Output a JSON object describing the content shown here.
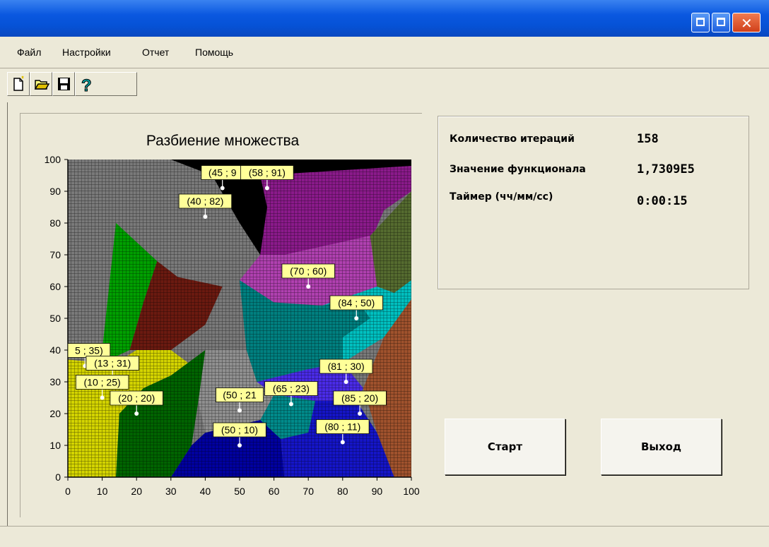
{
  "menu": [
    "Файл",
    "Настройки",
    "Отчет",
    "Помощь"
  ],
  "toolbar": [
    {
      "name": "new-file-icon"
    },
    {
      "name": "open-folder-icon"
    },
    {
      "name": "save-disk-icon"
    },
    {
      "name": "help-question-icon"
    }
  ],
  "info": {
    "iterations_label": "Количество итераций",
    "iterations_value": "158",
    "functional_label": "Значение функционала",
    "functional_value": "1,7309E5",
    "timer_label": "Таймер (чч/мм/сс)",
    "timer_value": "0:00:15"
  },
  "buttons": {
    "start": "Старт",
    "exit": "Выход"
  },
  "chart_data": {
    "type": "scatter",
    "title": "Разбиение множества",
    "xlim": [
      0,
      100
    ],
    "ylim": [
      0,
      100
    ],
    "xticks": [
      0,
      10,
      20,
      30,
      40,
      50,
      60,
      70,
      80,
      90,
      100
    ],
    "yticks": [
      0,
      10,
      20,
      30,
      40,
      50,
      60,
      70,
      80,
      90,
      100
    ],
    "grid": true,
    "points": [
      {
        "x": 45,
        "y": 91,
        "label": "(45 ; 9"
      },
      {
        "x": 58,
        "y": 91,
        "label": "(58 ; 91)"
      },
      {
        "x": 40,
        "y": 82,
        "label": "(40 ; 82)"
      },
      {
        "x": 70,
        "y": 60,
        "label": "(70 ; 60)"
      },
      {
        "x": 84,
        "y": 50,
        "label": "(84 ; 50)"
      },
      {
        "x": 5,
        "y": 35,
        "label": "5 ; 35)"
      },
      {
        "x": 13,
        "y": 31,
        "label": "(13 ; 31)"
      },
      {
        "x": 10,
        "y": 25,
        "label": "(10 ; 25)"
      },
      {
        "x": 20,
        "y": 20,
        "label": "(20 ; 20)"
      },
      {
        "x": 50,
        "y": 21,
        "label": "(50 ; 21"
      },
      {
        "x": 65,
        "y": 23,
        "label": "(65 ; 23)"
      },
      {
        "x": 81,
        "y": 30,
        "label": "(81 ; 30)"
      },
      {
        "x": 85,
        "y": 20,
        "label": "(85 ; 20)"
      },
      {
        "x": 80,
        "y": 11,
        "label": "(80 ; 11)"
      },
      {
        "x": 50,
        "y": 10,
        "label": "(50 ; 10)"
      }
    ],
    "regions": [
      {
        "color": "#7a7a7a",
        "pts": [
          [
            0,
            100
          ],
          [
            100,
            100
          ],
          [
            100,
            0
          ],
          [
            0,
            0
          ]
        ]
      },
      {
        "color": "#000000",
        "pts": [
          [
            30,
            100
          ],
          [
            100,
            100
          ],
          [
            100,
            98
          ],
          [
            85,
            95
          ],
          [
            60,
            87
          ],
          [
            56,
            70
          ],
          [
            50,
            80
          ],
          [
            42,
            95
          ]
        ]
      },
      {
        "color": "#000000",
        "pts": [
          [
            48,
            100
          ],
          [
            58,
            100
          ],
          [
            62,
            88
          ],
          [
            56,
            70
          ],
          [
            52,
            78
          ]
        ]
      },
      {
        "color": "#8b1a8b",
        "pts": [
          [
            56,
            95
          ],
          [
            100,
            98
          ],
          [
            100,
            90
          ],
          [
            92,
            84
          ],
          [
            88,
            74
          ],
          [
            63,
            64
          ],
          [
            56,
            70
          ],
          [
            58,
            85
          ]
        ]
      },
      {
        "color": "#b040b0",
        "pts": [
          [
            50,
            62
          ],
          [
            56,
            70
          ],
          [
            63,
            70
          ],
          [
            88,
            76
          ],
          [
            90,
            60
          ],
          [
            84,
            56
          ],
          [
            74,
            54
          ],
          [
            60,
            55
          ]
        ]
      },
      {
        "color": "#556b2f",
        "pts": [
          [
            88,
            76
          ],
          [
            100,
            90
          ],
          [
            100,
            60
          ],
          [
            95,
            58
          ],
          [
            90,
            60
          ]
        ]
      },
      {
        "color": "#008080",
        "pts": [
          [
            50,
            62
          ],
          [
            60,
            55
          ],
          [
            74,
            54
          ],
          [
            84,
            56
          ],
          [
            88,
            50
          ],
          [
            80,
            36
          ],
          [
            70,
            34
          ],
          [
            55,
            30
          ],
          [
            52,
            40
          ]
        ]
      },
      {
        "color": "#00c0c0",
        "pts": [
          [
            74,
            54
          ],
          [
            90,
            60
          ],
          [
            95,
            58
          ],
          [
            100,
            62
          ],
          [
            100,
            56
          ],
          [
            92,
            44
          ],
          [
            80,
            36
          ],
          [
            80,
            44
          ],
          [
            88,
            50
          ],
          [
            84,
            56
          ]
        ]
      },
      {
        "color": "#a0522d",
        "pts": [
          [
            92,
            44
          ],
          [
            100,
            56
          ],
          [
            100,
            0
          ],
          [
            95,
            0
          ],
          [
            90,
            14
          ],
          [
            86,
            28
          ]
        ]
      },
      {
        "color": "#4a2be8",
        "pts": [
          [
            55,
            30
          ],
          [
            70,
            34
          ],
          [
            80,
            36
          ],
          [
            86,
            28
          ],
          [
            84,
            24
          ],
          [
            72,
            24
          ],
          [
            60,
            26
          ]
        ]
      },
      {
        "color": "#008b8b",
        "pts": [
          [
            56,
            18
          ],
          [
            60,
            26
          ],
          [
            72,
            24
          ],
          [
            70,
            14
          ],
          [
            62,
            12
          ]
        ]
      },
      {
        "color": "#0000a0",
        "pts": [
          [
            30,
            0
          ],
          [
            63,
            0
          ],
          [
            62,
            12
          ],
          [
            56,
            18
          ],
          [
            40,
            14
          ],
          [
            36,
            10
          ]
        ]
      },
      {
        "color": "#1515c8",
        "pts": [
          [
            63,
            0
          ],
          [
            95,
            0
          ],
          [
            90,
            14
          ],
          [
            84,
            24
          ],
          [
            72,
            24
          ],
          [
            70,
            14
          ],
          [
            62,
            12
          ]
        ]
      },
      {
        "color": "#909090",
        "pts": [
          [
            38,
            24
          ],
          [
            40,
            14
          ],
          [
            56,
            18
          ],
          [
            60,
            26
          ],
          [
            55,
            30
          ],
          [
            52,
            40
          ],
          [
            40,
            40
          ]
        ]
      },
      {
        "color": "#00a000",
        "pts": [
          [
            14,
            80
          ],
          [
            26,
            68
          ],
          [
            22,
            55
          ],
          [
            18,
            40
          ],
          [
            10,
            36
          ],
          [
            10,
            40
          ]
        ]
      },
      {
        "color": "#6b1a10",
        "pts": [
          [
            22,
            55
          ],
          [
            26,
            68
          ],
          [
            32,
            63
          ],
          [
            45,
            60
          ],
          [
            40,
            48
          ],
          [
            30,
            40
          ],
          [
            18,
            40
          ]
        ]
      },
      {
        "color": "#d4d400",
        "pts": [
          [
            0,
            37
          ],
          [
            0,
            0
          ],
          [
            14,
            0
          ],
          [
            15,
            20
          ],
          [
            22,
            28
          ],
          [
            30,
            32
          ],
          [
            35,
            36
          ],
          [
            30,
            40
          ],
          [
            20,
            40
          ],
          [
            14,
            36
          ],
          [
            10,
            36
          ]
        ]
      },
      {
        "color": "#006400",
        "pts": [
          [
            14,
            0
          ],
          [
            30,
            0
          ],
          [
            36,
            10
          ],
          [
            38,
            24
          ],
          [
            40,
            40
          ],
          [
            35,
            36
          ],
          [
            30,
            32
          ],
          [
            22,
            28
          ],
          [
            15,
            20
          ]
        ]
      }
    ]
  }
}
